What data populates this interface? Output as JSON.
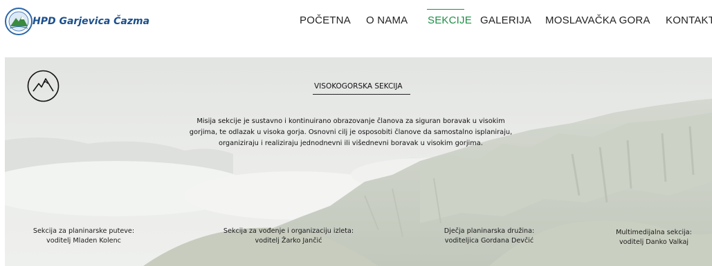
{
  "site": {
    "name": "HPD Garjevica Čazma",
    "logo_ring_text": "ČAZMA"
  },
  "nav": {
    "items": [
      {
        "label": "POČETNA",
        "active": false
      },
      {
        "label": "O NAMA",
        "active": false
      },
      {
        "label": "SEKCIJE",
        "active": true
      },
      {
        "label": "GALERIJA",
        "active": false
      },
      {
        "label": "MOSLAVAČKA GORA",
        "active": false
      },
      {
        "label": "KONTAKT",
        "active": false
      }
    ]
  },
  "section": {
    "icon": "mountain-icon",
    "title": "VISOKOGORSKA SEKCIJA",
    "mission_lines": [
      "Misija sekcije je sustavno i kontinuirano obrazovanje članova za siguran boravak u visokim",
      "gorjima, te odlazak u visoka gorja. Osnovni cilj je osposobiti članove da samostalno isplaniraju,",
      "organiziraju i realiziraju jednodnevni ili višednevni boravak u visokim gorjima."
    ]
  },
  "subsections": [
    {
      "name": "Sekcija za planinarske puteve:",
      "leader": "voditelj Mladen Kolenc"
    },
    {
      "name": "Sekcija za vođenje i organizaciju izleta:",
      "leader": "voditelj Žarko Jančić"
    },
    {
      "name": "Dječja planinarska družina:",
      "leader": "voditeljica Gordana Devčić"
    },
    {
      "name": "Multimedijalna sekcija:",
      "leader": "voditelj Danko Valkaj"
    }
  ],
  "colors": {
    "brand": "#1b4f8c",
    "nav_active": "#1d8e45",
    "text": "#222222"
  }
}
